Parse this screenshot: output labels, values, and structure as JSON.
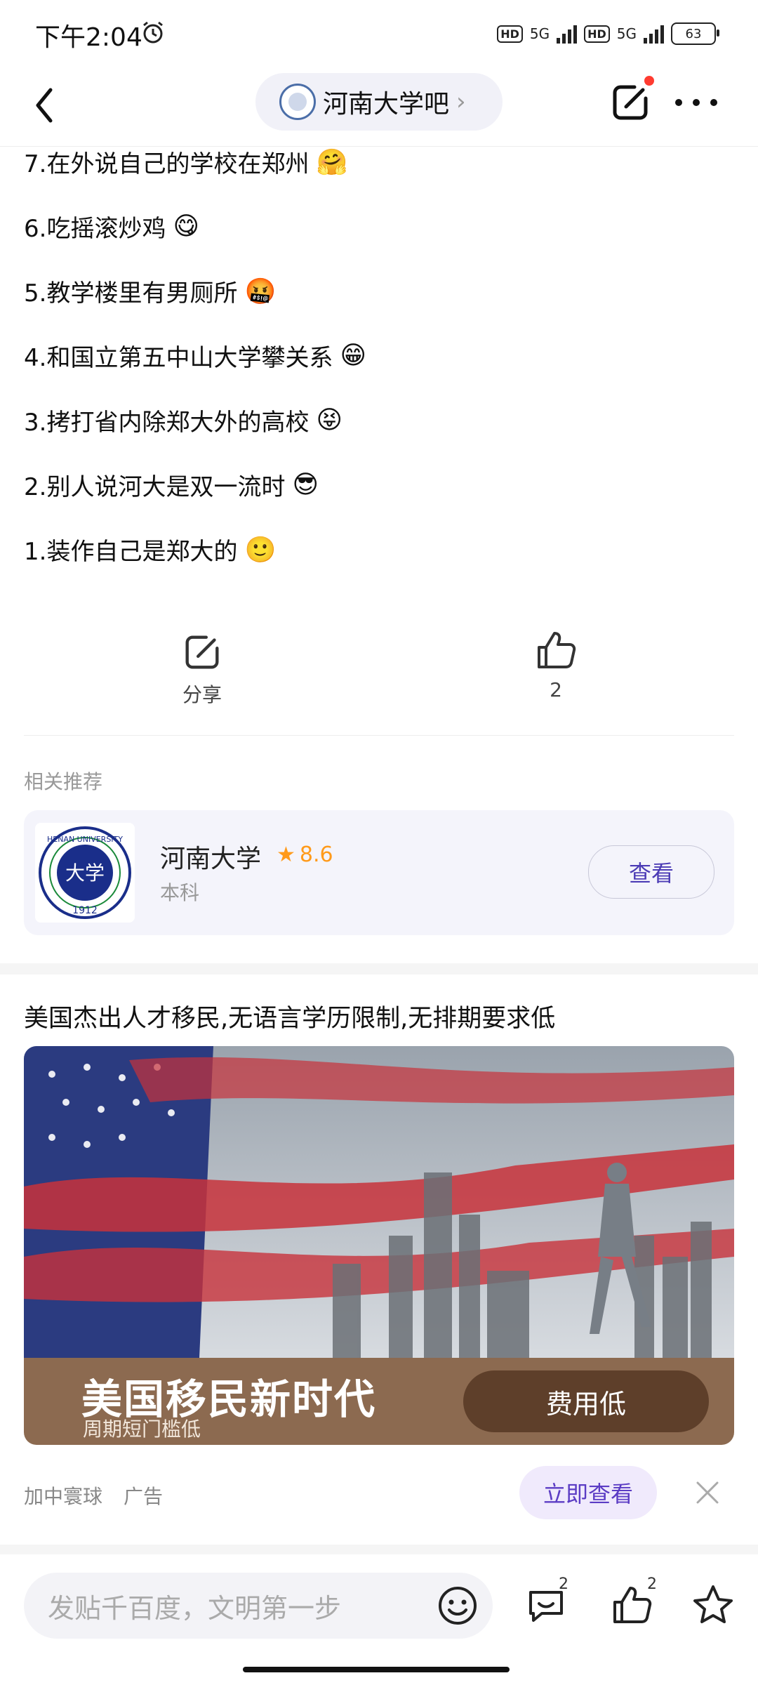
{
  "status_bar": {
    "time": "下午2:04",
    "net1": "5G",
    "net2": "5G",
    "hd": "HD",
    "battery": "63"
  },
  "nav": {
    "forum_name": "河南大学吧"
  },
  "post_lines": [
    {
      "text": "7.在外说自己的学校在郑州",
      "emoji": "🤗"
    },
    {
      "text": "6.吃摇滚炒鸡",
      "emoji": "😋"
    },
    {
      "text": "5.教学楼里有男厕所",
      "emoji": "🤬"
    },
    {
      "text": "4.和国立第五中山大学攀关系",
      "emoji": "😁"
    },
    {
      "text": "3.拷打省内除郑大外的高校",
      "emoji": "😝"
    },
    {
      "text": "2.别人说河大是双一流时",
      "emoji": "😎"
    },
    {
      "text": "1.装作自己是郑大的",
      "emoji": "🙂"
    }
  ],
  "actions": {
    "share_label": "分享",
    "like_count": "2"
  },
  "related": {
    "title": "相关推荐",
    "school_name": "河南大学",
    "rating": "8.6",
    "school_type": "本科",
    "view_label": "查看",
    "logo_text_top": "HENAN UNIVERSITY",
    "logo_year": "1912"
  },
  "ad": {
    "title": "美国杰出人才移民,无语言学历限制,无排期要求低",
    "headline": "美国移民新时代",
    "subline": "周期短门槛低",
    "price_label": "费用低",
    "source": "加中寰球",
    "label": "广告",
    "cta": "立即查看"
  },
  "bottom_bar": {
    "placeholder": "发贴千百度，文明第一步",
    "comment_count": "2",
    "like_count": "2"
  },
  "colors": {
    "accent": "#4b3bb5",
    "rating": "#ff9a1a",
    "ad_banner": "#8c6a50",
    "ad_button": "#5e3f2a"
  }
}
